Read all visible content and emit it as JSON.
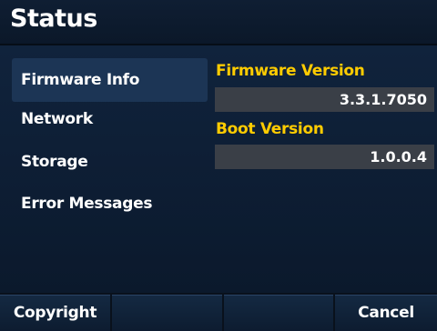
{
  "title": "Status",
  "menu": {
    "items": [
      {
        "label": "Firmware Info",
        "selected": true
      },
      {
        "label": "Network",
        "selected": false
      },
      {
        "label": "Storage",
        "selected": false
      },
      {
        "label": "Error Messages",
        "selected": false
      }
    ]
  },
  "details": {
    "firmware_version_label": "Firmware Version",
    "firmware_version_value": "3.3.1.7050",
    "boot_version_label": "Boot Version",
    "boot_version_value": "1.0.0.4"
  },
  "softkeys": {
    "key1": "Copyright",
    "key2": "",
    "key3": "",
    "key4": "Cancel"
  },
  "colors": {
    "label_accent": "#ffcc00",
    "background": "#10233c",
    "selected_item": "#1c3555"
  }
}
